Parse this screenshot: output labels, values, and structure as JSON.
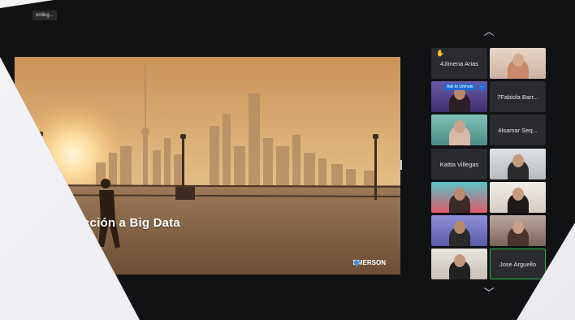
{
  "recording": {
    "label": "ording..."
  },
  "shared_screen": {
    "title": "cción a Big Data",
    "logo": "EMERSON"
  },
  "gallery": {
    "scroll_up_icon": "chevron-up-icon",
    "scroll_down_icon": "chevron-down-icon",
    "unmute_label": "Ask to Unmute",
    "unmute_more": "···",
    "participants": [
      {
        "name": "4Jimena Arias",
        "video": false,
        "hand_raised": true
      },
      {
        "name": "",
        "video": true
      },
      {
        "name": "",
        "video": true
      },
      {
        "name": "7Fabiola Barr...",
        "video": false
      },
      {
        "name": "",
        "video": true
      },
      {
        "name": "4Isamar Seq...",
        "video": false
      },
      {
        "name": "Kattia Villegas",
        "video": false
      },
      {
        "name": "",
        "video": true
      },
      {
        "name": "",
        "video": true
      },
      {
        "name": "",
        "video": true
      },
      {
        "name": "",
        "video": true
      },
      {
        "name": "",
        "video": true
      },
      {
        "name": "",
        "video": true
      },
      {
        "name": "Jose Arguello",
        "video": false,
        "active_speaker": true
      }
    ]
  }
}
